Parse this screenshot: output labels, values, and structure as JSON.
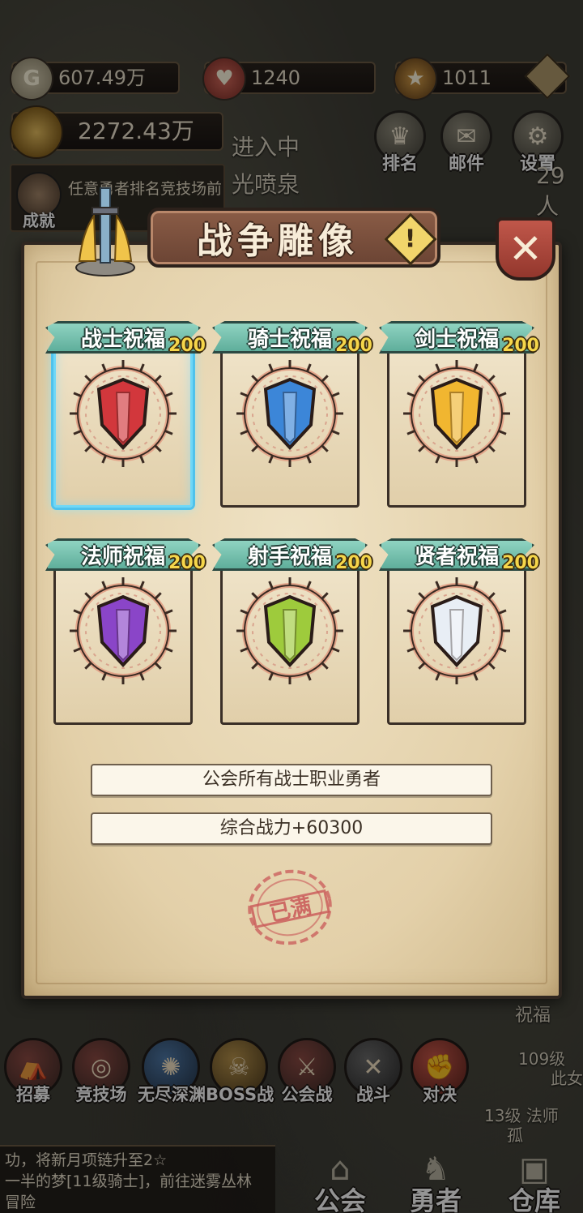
{
  "hud": {
    "gold": "607.49万",
    "gems": "1240",
    "medals": "1011",
    "power": "2272.43万"
  },
  "top_buttons": [
    {
      "label": "排名",
      "icon": "trophy-icon"
    },
    {
      "label": "邮件",
      "icon": "mail-icon"
    },
    {
      "label": "设置",
      "icon": "gear-icon"
    }
  ],
  "background_texts": {
    "entering": "进入中",
    "fountain": "光喷泉",
    "online_count": "29人",
    "achievement_hint": "任意勇者排名竞技场前",
    "achievement_label": "成就",
    "blessing_side": "祝福",
    "side_hero_1": "109级",
    "side_hero_1b": "此女",
    "side_hero_2": "13级 法师",
    "side_hero_2b": "孤"
  },
  "modal": {
    "title": "战争雕像",
    "info_icon": "exclamation-icon",
    "close_icon": "close-icon",
    "cards": [
      {
        "label": "战士祝福",
        "level": "200",
        "icon": "warrior-shield-emblem-icon",
        "color": "#d2373c",
        "selected": true
      },
      {
        "label": "骑士祝福",
        "level": "200",
        "icon": "knight-helmet-emblem-icon",
        "color": "#3c86d8",
        "selected": false
      },
      {
        "label": "剑士祝福",
        "level": "200",
        "icon": "winged-sword-emblem-icon",
        "color": "#f1b630",
        "selected": false
      },
      {
        "label": "法师祝福",
        "level": "200",
        "icon": "mage-purple-flame-emblem-icon",
        "color": "#8a45c8",
        "selected": false
      },
      {
        "label": "射手祝福",
        "level": "200",
        "icon": "archer-crossbow-emblem-icon",
        "color": "#9ecb3c",
        "selected": false
      },
      {
        "label": "贤者祝福",
        "level": "200",
        "icon": "sage-white-flame-emblem-icon",
        "color": "#e8eef5",
        "selected": false
      }
    ],
    "description": "公会所有战士职业勇者",
    "bonus": "综合战力+60300",
    "status_stamp": "已满"
  },
  "bottom_buttons": [
    {
      "label": "招募",
      "icon": "tent-icon"
    },
    {
      "label": "竞技场",
      "icon": "target-icon"
    },
    {
      "label": "无尽深渊",
      "icon": "vortex-icon"
    },
    {
      "label": "BOSS战",
      "icon": "skull-helmet-icon"
    },
    {
      "label": "公会战",
      "icon": "crossed-swords-banner-icon"
    },
    {
      "label": "战斗",
      "icon": "crossed-blades-icon"
    },
    {
      "label": "对决",
      "icon": "fist-icon"
    }
  ],
  "chat": {
    "line1": "功，将新月项链升至2☆",
    "line2": "一半的梦[11级骑士]，前往迷雾丛林",
    "line3": "冒险"
  },
  "nav": [
    {
      "label": "公会",
      "icon": "guild-hall-icon"
    },
    {
      "label": "勇者",
      "icon": "horned-helmet-icon"
    },
    {
      "label": "仓库",
      "icon": "warehouse-icon"
    }
  ]
}
